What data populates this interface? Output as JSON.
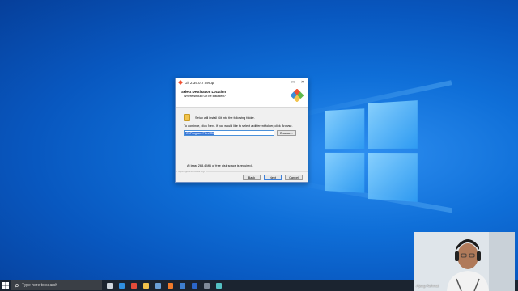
{
  "dialog": {
    "title": "Git 2.39.0.2 Setup",
    "header_title": "Select Destination Location",
    "header_subtitle": "Where should Git be installed?",
    "install_text": "Setup will install Git into the following folder.",
    "continue_text": "To continue, click Next. If you would like to select a different folder, click Browse.",
    "path_value": "C:\\Program Files\\Git",
    "browse_label": "Browse...",
    "space_text": "At least 263.4 MB of free disk space is required.",
    "footer_url": "https://gitforwindows.org/",
    "back_label": "Back",
    "next_label": "Next",
    "cancel_label": "Cancel",
    "minimize_glyph": "—",
    "maximize_glyph": "□",
    "close_glyph": "✕"
  },
  "taskbar": {
    "search_placeholder": "Type here to search",
    "icons": [
      {
        "name": "task-view-icon",
        "color": "#cfd6de"
      },
      {
        "name": "edge-icon",
        "color": "#2f8fe0"
      },
      {
        "name": "chrome-icon",
        "color": "#e44c3a"
      },
      {
        "name": "file-explorer-icon",
        "color": "#f2c24b"
      },
      {
        "name": "photos-icon",
        "color": "#6aa0d8"
      },
      {
        "name": "firefox-icon",
        "color": "#f07b2b"
      },
      {
        "name": "terminal-icon",
        "color": "#3e7fd0"
      },
      {
        "name": "word-icon",
        "color": "#2b66c9"
      },
      {
        "name": "app-icon",
        "color": "#7f8a99"
      },
      {
        "name": "git-setup-icon",
        "color": "#54c1c4"
      }
    ]
  },
  "webcam": {
    "name_label": "Ajang Rahmat"
  },
  "colors": {
    "desktop_blue": "#0f6fd8",
    "taskbar": "#1b2430",
    "selection": "#3a78d8"
  }
}
